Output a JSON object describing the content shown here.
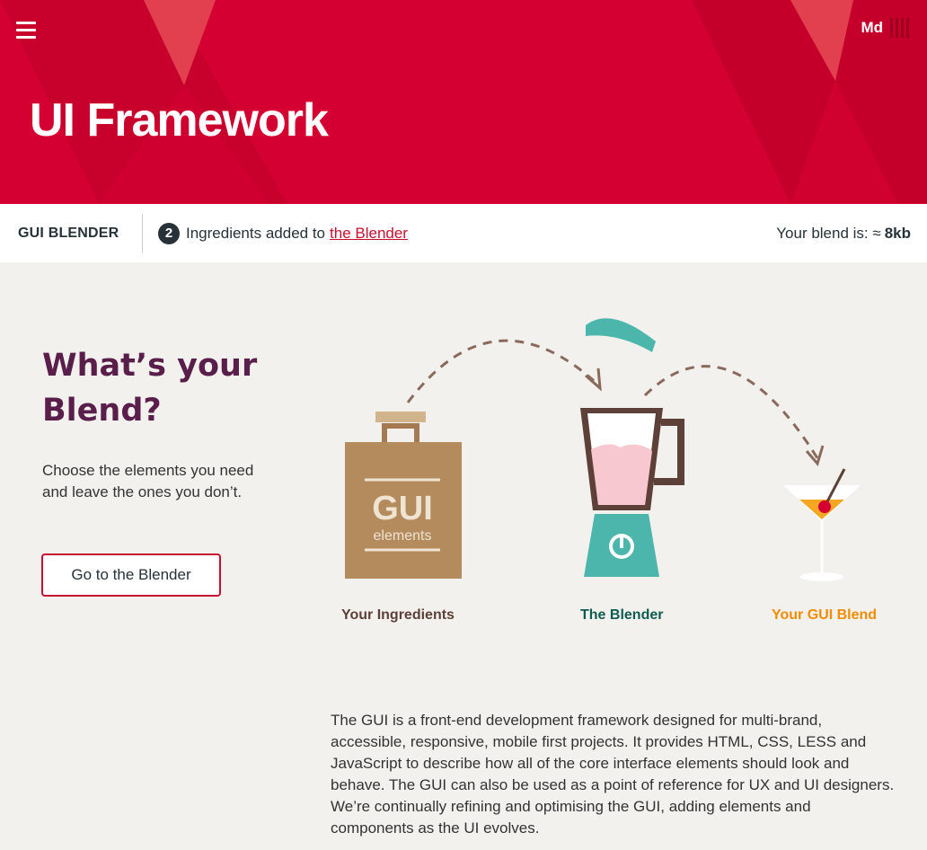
{
  "header": {
    "title_strong": "UI",
    "title_rest": "Framework",
    "brand": "Md",
    "menu_icon": "hamburger-icon",
    "colors": {
      "primary": "#d50032"
    }
  },
  "blender_bar": {
    "label": "GUI BLENDER",
    "count": "2",
    "text": "Ingredients added to",
    "link": "the Blender",
    "size_label": "Your blend is: ≈",
    "size_value": "8kb"
  },
  "intro": {
    "title": "What’s your Blend?",
    "text": "Choose the elements you need and leave the ones you don’t.",
    "button": "Go to the Blender"
  },
  "illustration": {
    "bag_text": "GUI",
    "bag_subtext": "elements",
    "captions": [
      "Your Ingredients",
      "The Blender",
      "Your GUI Blend"
    ]
  },
  "description": "The GUI is a front-end development framework designed for multi-brand, accessible, responsive, mobile first projects. It provides HTML, CSS, LESS and JavaScript to describe how all of the core interface elements should look and behave. The GUI can also be used as a point of reference for UX and UI designers. We’re continually refining and optimising the GUI, adding elements and components as the UI evolves."
}
